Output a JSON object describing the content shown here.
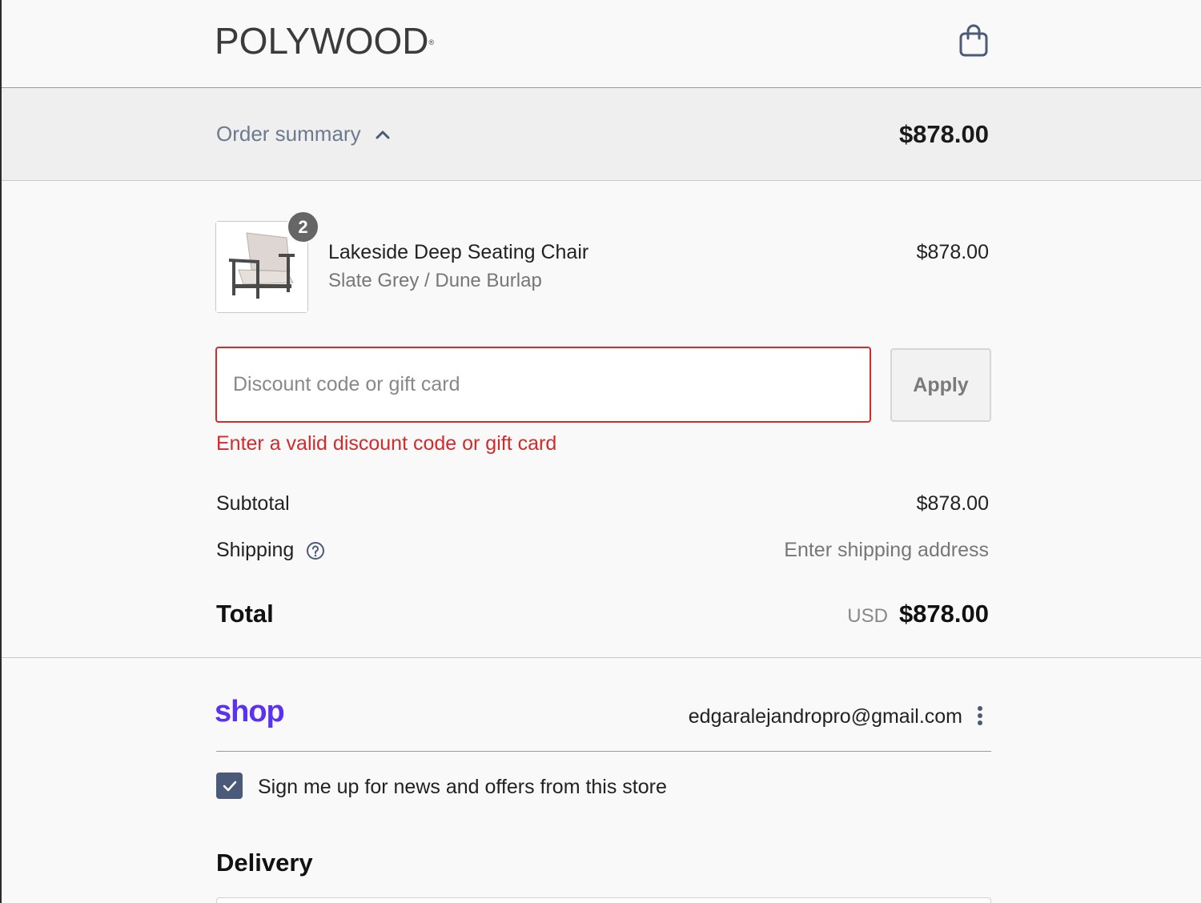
{
  "header": {
    "brand": "POLYWOOD",
    "brand_mark": "®",
    "cart_icon": "shopping-bag-icon"
  },
  "order_summary": {
    "toggle_label": "Order summary",
    "toggle_icon": "chevron-up-icon",
    "total": "$878.00"
  },
  "line_item": {
    "quantity": "2",
    "name": "Lakeside Deep Seating Chair",
    "variant": "Slate Grey / Dune Burlap",
    "price": "$878.00",
    "image_icon": "chair-image"
  },
  "discount": {
    "placeholder": "Discount code or gift card",
    "value": "",
    "apply_label": "Apply",
    "error": "Enter a valid discount code or gift card",
    "error_color": "#d12b2b"
  },
  "totals": {
    "subtotal_label": "Subtotal",
    "subtotal_value": "$878.00",
    "shipping_label": "Shipping",
    "shipping_value": "Enter shipping address",
    "shipping_help_icon": "question-circle-icon",
    "total_label": "Total",
    "currency": "USD",
    "total_value": "$878.00"
  },
  "shop_pay": {
    "logo": "shop",
    "logo_color": "#5a31f4",
    "email": "edgaralejandropro@gmail.com",
    "menu_icon": "more-vertical-icon"
  },
  "newsletter": {
    "checked": true,
    "label": "Sign me up for news and offers from this store"
  },
  "delivery": {
    "heading": "Delivery"
  }
}
